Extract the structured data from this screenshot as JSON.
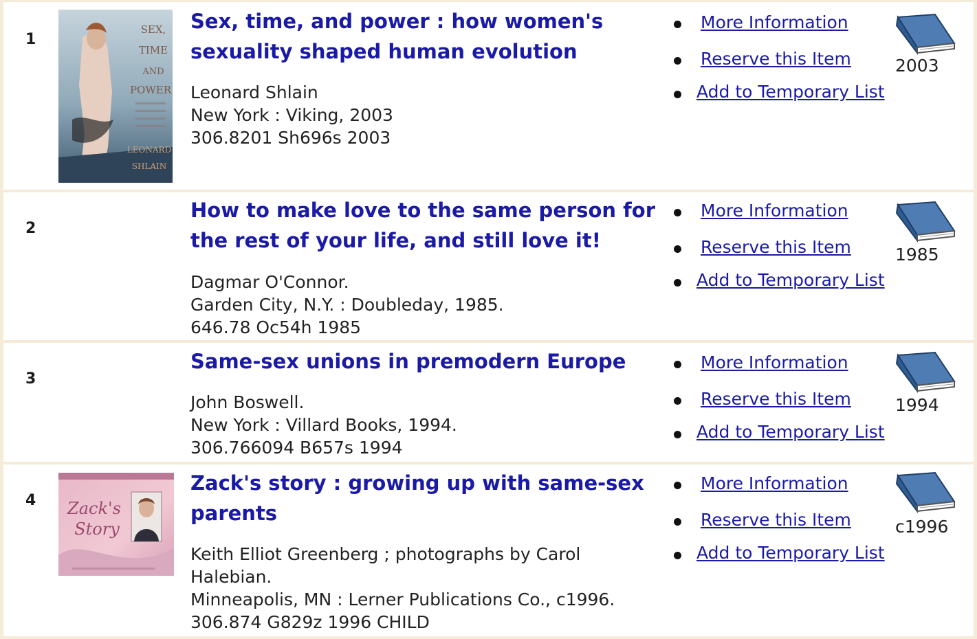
{
  "items": [
    {
      "number": "1",
      "title_line1": "Sex, time, and power : how women's",
      "title_line2": "sexuality shaped human evolution",
      "author": "Leonard Shlain",
      "publisher": "New York : Viking, 2003",
      "call_number": "306.8201 Sh696s 2003",
      "year": "2003",
      "cover": {
        "words": [
          "SEX,",
          "TIME",
          "AND",
          "POWER"
        ],
        "author_words": [
          "LEONARD",
          "SHLAIN"
        ]
      }
    },
    {
      "number": "2",
      "title_line1": "How to make love to the same person for",
      "title_line2": "the rest of your life, and still love it!",
      "author": "Dagmar O'Connor.",
      "publisher": "Garden City, N.Y. : Doubleday, 1985.",
      "call_number": "646.78 Oc54h 1985",
      "year": "1985"
    },
    {
      "number": "3",
      "title_line1": "Same-sex unions in premodern Europe",
      "author": "John Boswell.",
      "publisher": "New York : Villard Books, 1994.",
      "call_number": "306.766094 B657s 1994",
      "year": "1994"
    },
    {
      "number": "4",
      "title_line1": "Zack's story : growing up with same-sex",
      "title_line2": "parents",
      "author": "Keith Elliot Greenberg ; photographs by Carol",
      "author_line2": "Halebian.",
      "publisher": "Minneapolis, MN : Lerner Publications Co., c1996.",
      "call_number": "306.874 G829z 1996 CHILD",
      "year": "c1996",
      "cover": {
        "words": [
          "Zack's",
          "Story"
        ]
      }
    }
  ],
  "actions": {
    "more_info": "More Information",
    "reserve": "Reserve this Item",
    "add_temp": "Add to Temporary List"
  },
  "colors": {
    "link": "#1a1aa6",
    "row_background": "#ffffff",
    "separator": "#f4ecd8",
    "book_icon": "#4f7db3"
  },
  "icons": {
    "format": "book-icon",
    "bullet": "bullet-icon"
  }
}
